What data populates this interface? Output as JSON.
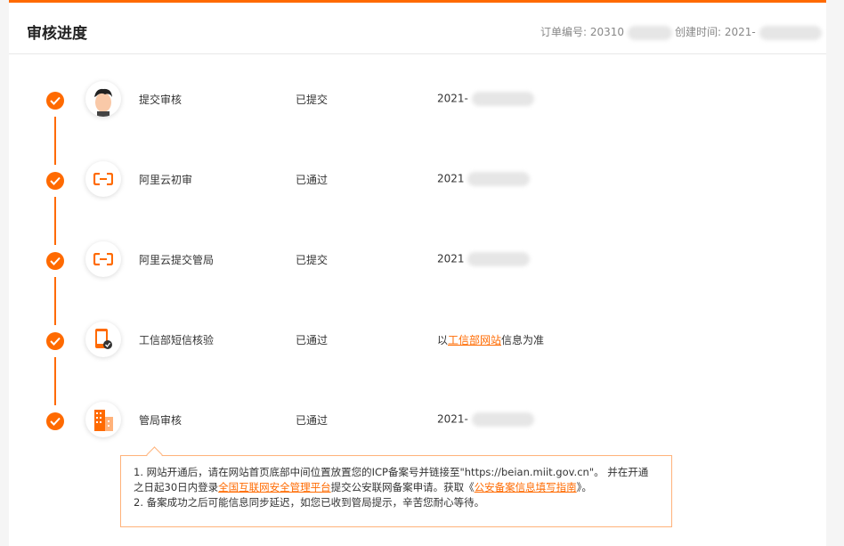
{
  "header": {
    "title": "审核进度",
    "order_label": "订单编号: 20310",
    "created_label": "创建时间: 2021-"
  },
  "steps": [
    {
      "name": "提交审核",
      "status": "已提交",
      "time": "2021-",
      "icon": "person-avatar-icon"
    },
    {
      "name": "阿里云初审",
      "status": "已通过",
      "time": "2021",
      "icon": "aliyun-logo-icon"
    },
    {
      "name": "阿里云提交管局",
      "status": "已提交",
      "time": "2021",
      "icon": "aliyun-logo-icon"
    },
    {
      "name": "工信部短信核验",
      "status": "已通过",
      "time_prefix": "以",
      "time_link": "工信部网站",
      "time_suffix": "信息为准",
      "icon": "phone-verify-icon"
    },
    {
      "name": "管局审核",
      "status": "已通过",
      "time": "2021-",
      "icon": "building-icon"
    }
  ],
  "notice": {
    "line1": "1. 网站开通后，请在网站首页底部中间位置放置您的ICP备案号并链接至\"https://beian.miit.gov.cn\"。 并在开通",
    "line2_prefix": "之日起30日内登录",
    "line2_link1": "全国互联网安全管理平台",
    "line2_middle": "提交公安联网备案申请。获取《",
    "line2_link2": "公安备案信息填写指南",
    "line2_suffix": "》。",
    "line3": "2. 备案成功之后可能信息同步延迟，如您已收到管局提示，辛苦您耐心等待。"
  },
  "colors": {
    "accent": "#ff6a00"
  }
}
